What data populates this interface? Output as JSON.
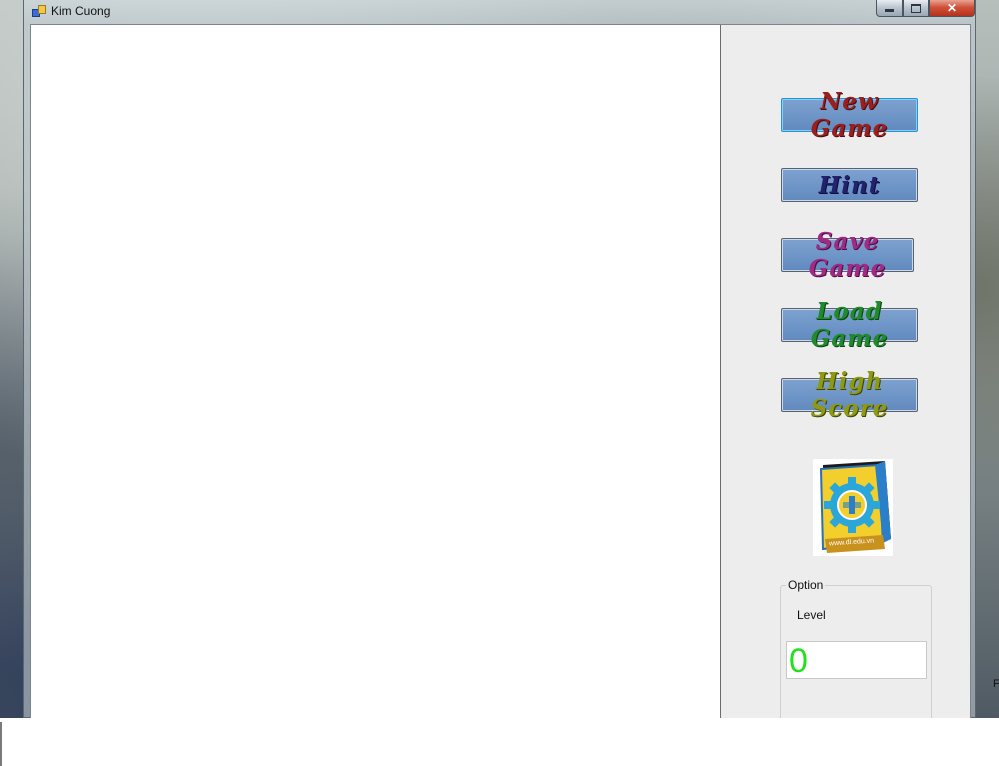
{
  "window": {
    "title": "Kim Cuong",
    "close_glyph": "✕"
  },
  "sidebar": {
    "buttons": [
      {
        "label": "New Game",
        "color": "#9a2020"
      },
      {
        "label": "Hint",
        "color": "#22226e"
      },
      {
        "label": "Save Game",
        "color": "#a02a86"
      },
      {
        "label": "Load Game",
        "color": "#1f8b2c"
      },
      {
        "label": "High Score",
        "color": "#8f9a14"
      }
    ],
    "logo_text": "www.dl.edu.vn"
  },
  "option": {
    "legend": "Option",
    "level_label": "Level",
    "level_value": "0",
    "level_color": "#22e01a"
  },
  "edge_text": "F"
}
